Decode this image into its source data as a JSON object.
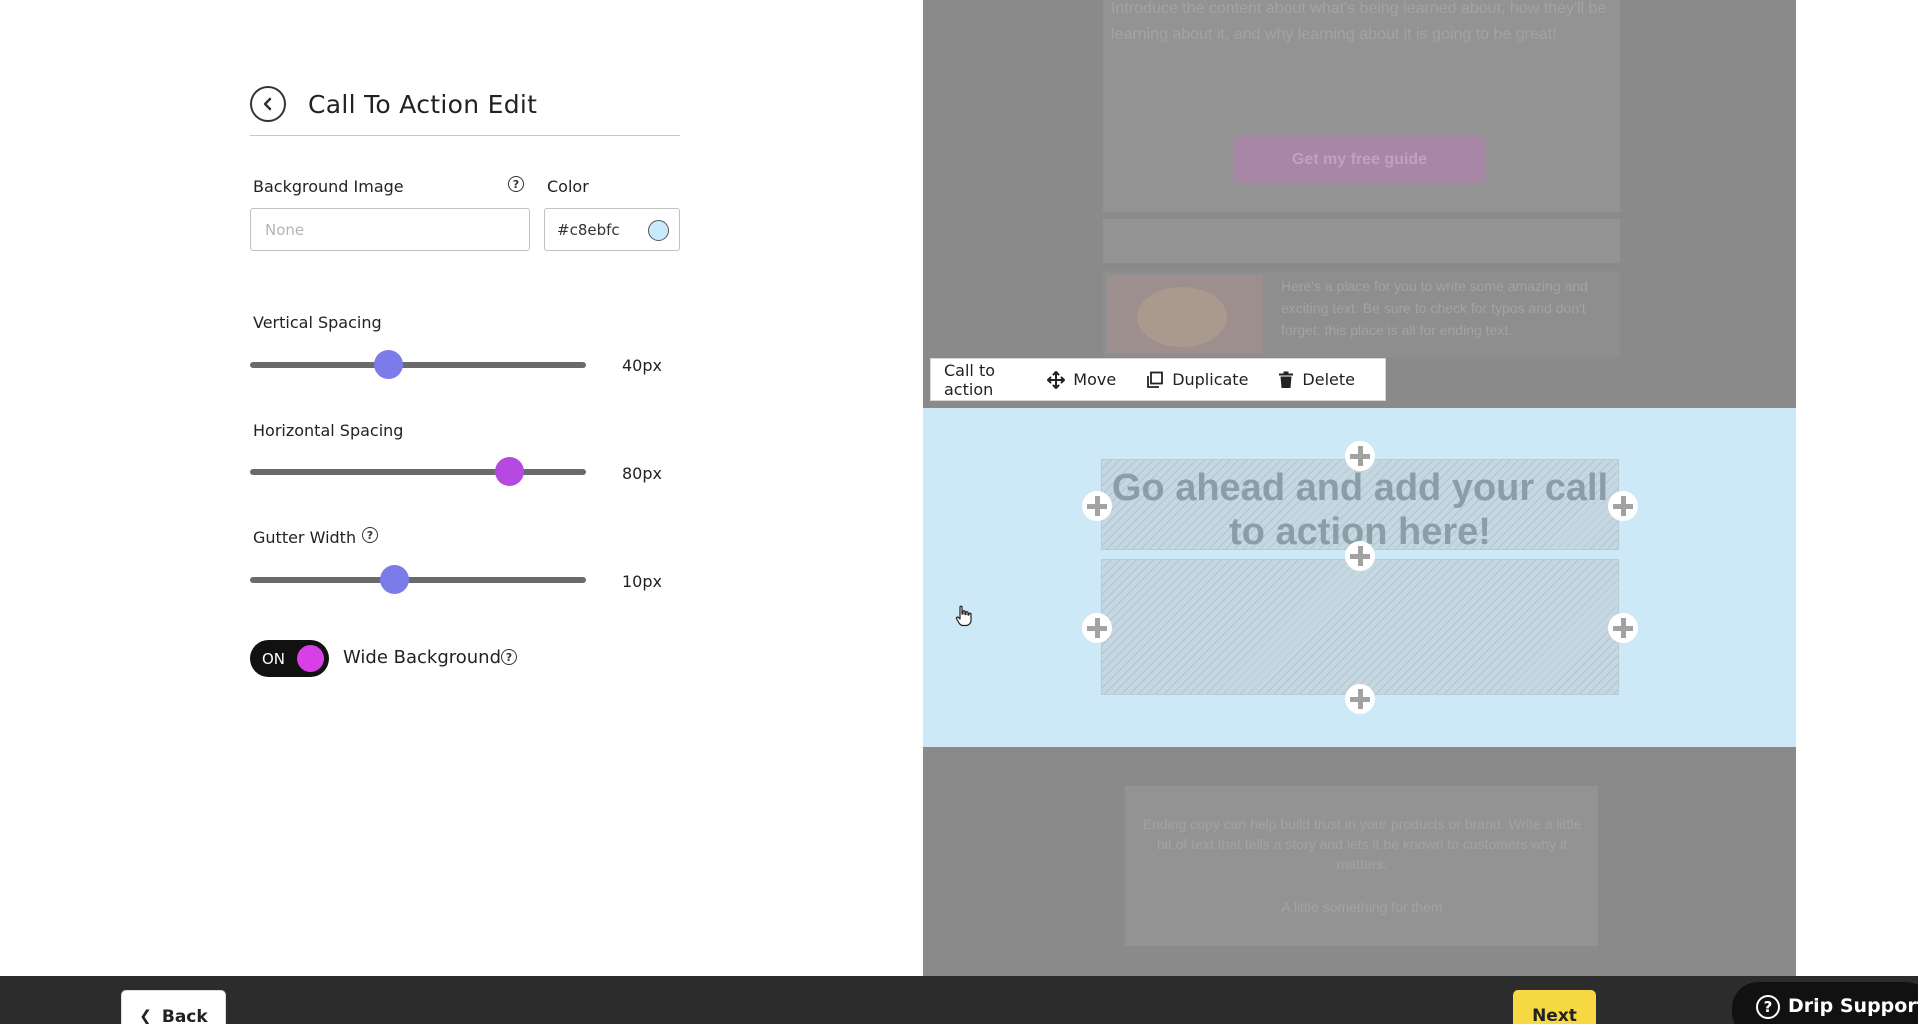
{
  "editor": {
    "title": "Call To Action Edit",
    "background_image": {
      "label": "Background Image",
      "placeholder": "None",
      "value": ""
    },
    "color": {
      "label": "Color",
      "value": "#c8ebfc",
      "swatch": "#c8ebfc"
    },
    "vertical_spacing": {
      "label": "Vertical Spacing",
      "value_label": "40px",
      "value": 40,
      "fraction": 0.41,
      "thumb_color": "#7b7bea"
    },
    "horizontal_spacing": {
      "label": "Horizontal Spacing",
      "value_label": "80px",
      "value": 80,
      "fraction": 0.77,
      "thumb_color": "#b64ae0"
    },
    "gutter_width": {
      "label": "Gutter Width",
      "value_label": "10px",
      "value": 10,
      "fraction": 0.43,
      "thumb_color": "#7b7bea"
    },
    "wide_background": {
      "toggle_label": "ON",
      "label": "Wide Background",
      "on": true
    }
  },
  "preview": {
    "dim_text_top": "Introduce the content about what's being learned about, how they'll be learning about it, and why learning about it is going to be great!",
    "dim_button": "Get my free guide",
    "dim_text_side": "Here's a place for you to write some amazing and exciting text. Be sure to check for typos and don't forget: this place is all for ending text.",
    "dim_footer_text": "Ending copy can help build trust in your products or brand. Write a little bit of text that tells a story and lets it be known to customers why it matters.",
    "dim_footer_link": "A little something for them",
    "toolbar": {
      "title": "Call to action",
      "move": "Move",
      "duplicate": "Duplicate",
      "delete": "Delete"
    },
    "cta_headline": "Go ahead and add your call to action here!",
    "section_bg": "#cde9f8"
  },
  "footer": {
    "back": "Back",
    "next": "Next",
    "support": "Drip Support"
  }
}
